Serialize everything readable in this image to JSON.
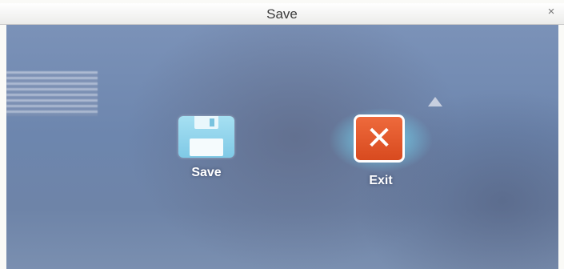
{
  "window": {
    "title": "Save",
    "close_icon": "close-icon",
    "close_glyph": "×"
  },
  "actions": [
    {
      "id": "save",
      "label": "Save",
      "icon": "floppy-disk-icon",
      "color": "#8fd3ec"
    },
    {
      "id": "exit",
      "label": "Exit",
      "icon": "x-icon",
      "color": "#e05a2c",
      "selected": true
    }
  ],
  "colors": {
    "background": "#6f88b0",
    "selection_glow": "#78e6ff"
  }
}
